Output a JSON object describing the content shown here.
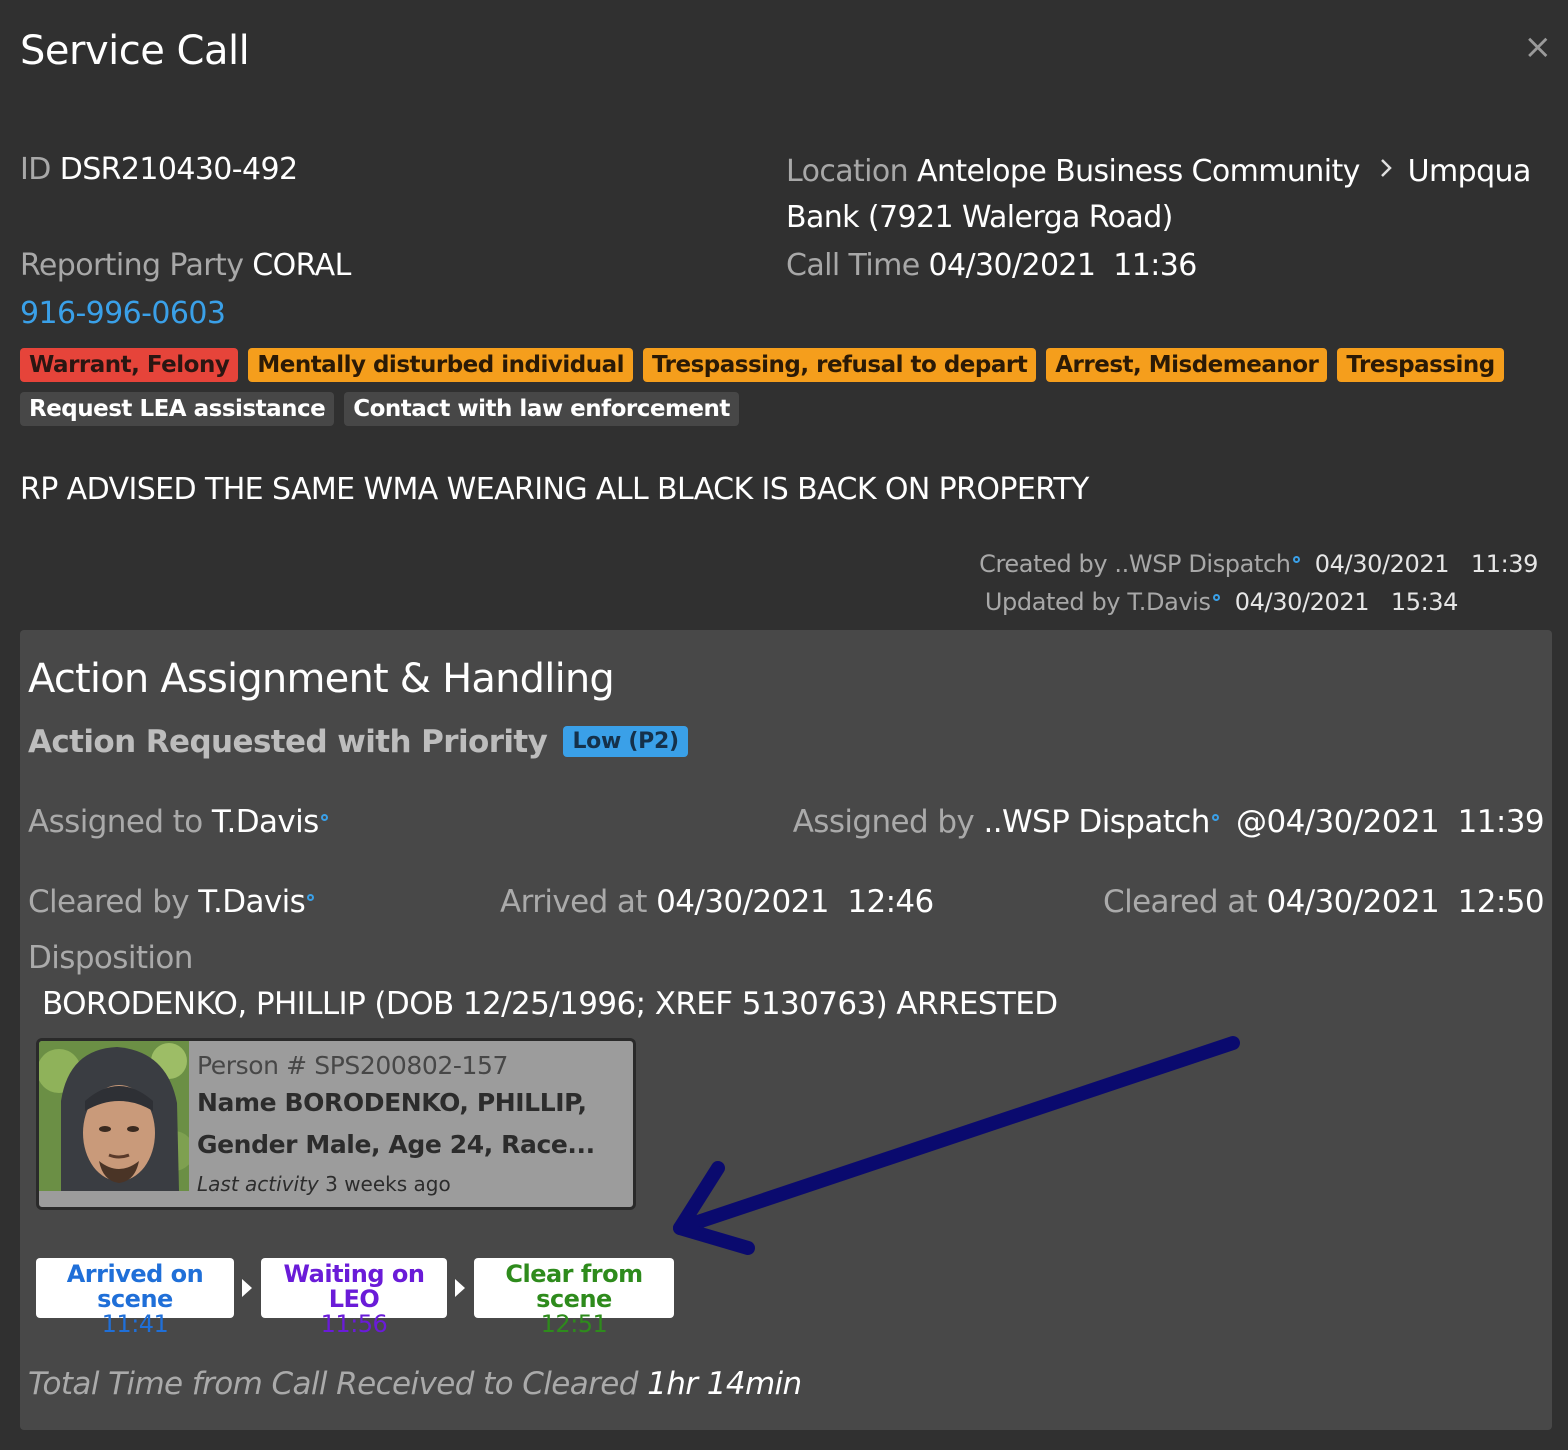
{
  "dialog": {
    "title": "Service Call",
    "close_label": "×"
  },
  "call": {
    "id_label": "ID",
    "id_value": "DSR210430-492",
    "location_label": "Location",
    "location_area": "Antelope Business Community",
    "location_site_line1": "Umpqua",
    "location_site_line2": "Bank (7921 Walerga Road)",
    "reporting_party_label": "Reporting Party",
    "reporting_party_value": "CORAL",
    "call_time_label": "Call Time",
    "call_time_date": "04/30/2021",
    "call_time_time": "11:36",
    "phone": "916-996-0603",
    "tags": [
      {
        "label": "Warrant, Felony",
        "color": "#e6443a"
      },
      {
        "label": "Mentally disturbed individual",
        "color": "#f59e1c"
      },
      {
        "label": "Trespassing, refusal to depart",
        "color": "#f59e1c"
      },
      {
        "label": "Arrest, Misdemeanor",
        "color": "#f59e1c"
      },
      {
        "label": "Trespassing",
        "color": "#f59e1c"
      },
      {
        "label": "Request LEA assistance",
        "color": "#474747"
      },
      {
        "label": "Contact with law enforcement",
        "color": "#474747"
      }
    ],
    "description": "RP ADVISED THE SAME WMA WEARING ALL BLACK IS BACK ON PROPERTY",
    "created_label": "Created by",
    "created_by": "..WSP Dispatch",
    "created_date": "04/30/2021",
    "created_time": "11:39",
    "updated_label": "Updated by",
    "updated_by": "T.Davis",
    "updated_date": "04/30/2021",
    "updated_time": "15:34"
  },
  "action": {
    "title": "Action Assignment & Handling",
    "requested_label": "Action Requested with Priority",
    "priority": "Low (P2)",
    "assigned_to_label": "Assigned to",
    "assigned_to": "T.Davis",
    "assigned_by_label": "Assigned by",
    "assigned_by": "..WSP Dispatch",
    "assigned_at_prefix": "@",
    "assigned_date": "04/30/2021",
    "assigned_time": "11:39",
    "cleared_by_label": "Cleared by",
    "cleared_by": "T.Davis",
    "arrived_label": "Arrived at",
    "arrived_date": "04/30/2021",
    "arrived_time": "12:46",
    "cleared_at_label": "Cleared at",
    "cleared_date": "04/30/2021",
    "cleared_time": "12:50",
    "disposition_label": "Disposition",
    "disposition_text": "BORODENKO, PHILLIP (DOB 12/25/1996; XREF 5130763) ARRESTED",
    "person": {
      "number_label": "Person #",
      "number": "SPS200802-157",
      "summary_line1": "Name BORODENKO, PHILLIP,",
      "summary_line2": "Gender Male, Age 24, Race...",
      "last_activity_label": "Last activity",
      "last_activity": "3 weeks ago"
    },
    "steps": [
      {
        "label": "Arrived on scene",
        "time": "11:41",
        "color": "#1f6fd8"
      },
      {
        "label": "Waiting on LEO",
        "time": "11:56",
        "color": "#6a1bd8"
      },
      {
        "label": "Clear from scene",
        "time": "12:51",
        "color": "#2e8b1c"
      }
    ],
    "total_label": "Total Time from Call Received to Cleared",
    "total_value": "1hr 14min"
  },
  "annotation": {
    "arrow_color": "#0a0a6e"
  }
}
